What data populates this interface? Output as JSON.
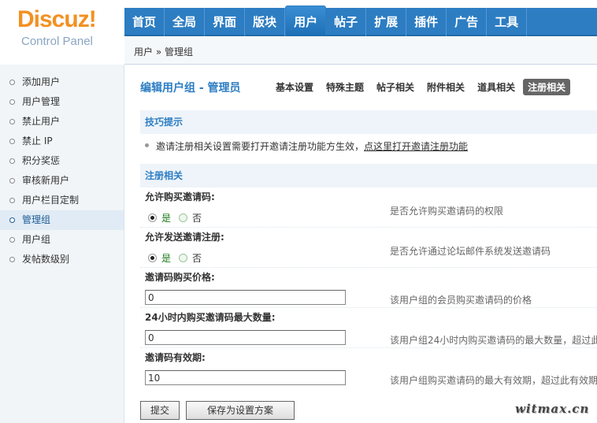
{
  "logo": {
    "brand": "Discuz",
    "bang": "!",
    "subtitle": "Control Panel"
  },
  "topnav": [
    {
      "label": "首页",
      "active": false
    },
    {
      "label": "全局",
      "active": false
    },
    {
      "label": "界面",
      "active": false
    },
    {
      "label": "版块",
      "active": false
    },
    {
      "label": "用户",
      "active": true
    },
    {
      "label": "帖子",
      "active": false
    },
    {
      "label": "扩展",
      "active": false
    },
    {
      "label": "插件",
      "active": false
    },
    {
      "label": "广告",
      "active": false
    },
    {
      "label": "工具",
      "active": false
    }
  ],
  "breadcrumb": "用户 » 管理组",
  "sidebar": [
    {
      "label": "添加用户",
      "active": false
    },
    {
      "label": "用户管理",
      "active": false
    },
    {
      "label": "禁止用户",
      "active": false
    },
    {
      "label": "禁止 IP",
      "active": false
    },
    {
      "label": "积分奖惩",
      "active": false
    },
    {
      "label": "审核新用户",
      "active": false
    },
    {
      "label": "用户栏目定制",
      "active": false
    },
    {
      "label": "管理组",
      "active": true
    },
    {
      "label": "用户组",
      "active": false
    },
    {
      "label": "发帖数级别",
      "active": false
    }
  ],
  "main": {
    "title": "编辑用户组 - 管理员",
    "subtabs": [
      {
        "label": "基本设置",
        "active": false
      },
      {
        "label": "特殊主题",
        "active": false
      },
      {
        "label": "帖子相关",
        "active": false
      },
      {
        "label": "附件相关",
        "active": false
      },
      {
        "label": "道具相关",
        "active": false
      },
      {
        "label": "注册相关",
        "active": true
      }
    ],
    "tips_header": "技巧提示",
    "tips_text": "邀请注册相关设置需要打开邀请注册功能方生效，",
    "tips_link": "点这里打开邀请注册功能",
    "section_header": "注册相关",
    "settings": {
      "allow_buy": {
        "label": "允许购买邀请码:",
        "yes": "是",
        "no": "否",
        "desc": "是否允许购买邀请码的权限"
      },
      "allow_send": {
        "label": "允许发送邀请注册:",
        "yes": "是",
        "no": "否",
        "desc": "是否允许通过论坛邮件系统发送邀请码"
      },
      "price": {
        "label": "邀请码购买价格:",
        "value": "0",
        "desc": "该用户组的会员购买邀请码的价格"
      },
      "max24": {
        "label": "24小时内购买邀请码最大数量:",
        "value": "0",
        "desc": "该用户组24小时内购买邀请码的最大数量，超过此"
      },
      "expiry": {
        "label": "邀请码有效期:",
        "value": "10",
        "desc": "该用户组购买邀请码的最大有效期，超过此有效期"
      }
    },
    "submit_label": "提交",
    "save_label": "保存为设置方案"
  },
  "watermark": "witmax.cn"
}
